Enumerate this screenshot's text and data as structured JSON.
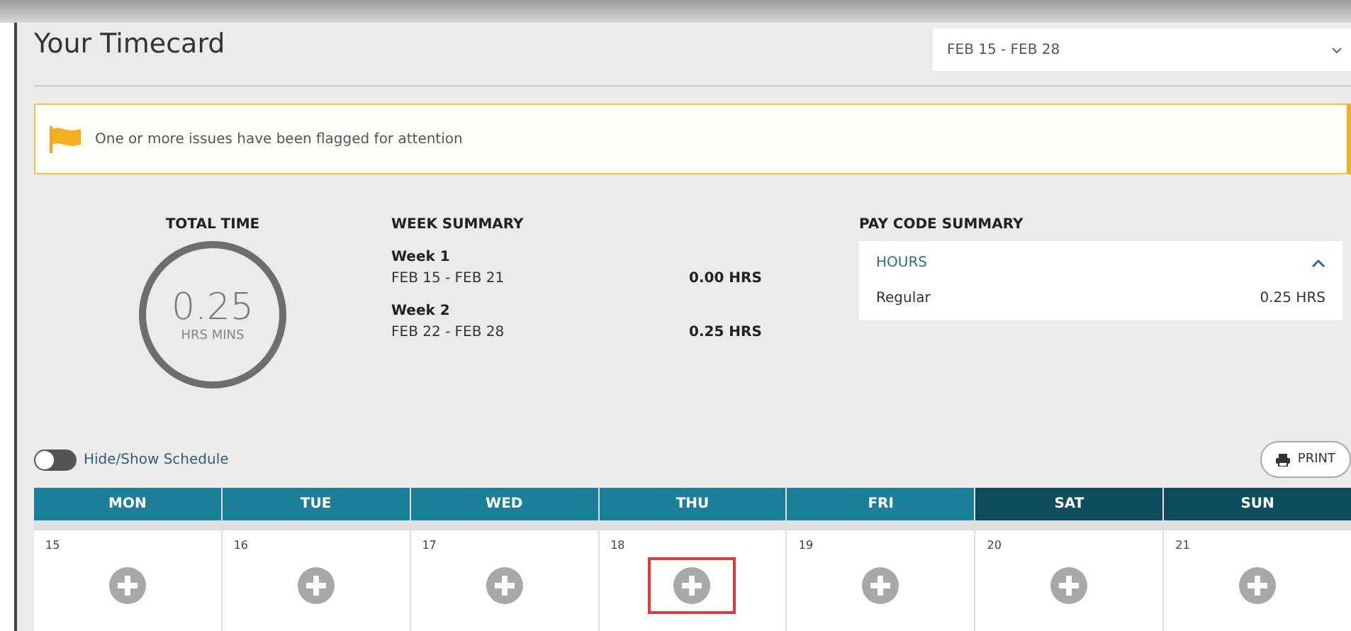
{
  "title": "Your Timecard",
  "period_select": {
    "value": "FEB 15 - FEB 28"
  },
  "alert": {
    "message": "One or more issues have been flagged for attention"
  },
  "total_time": {
    "heading": "TOTAL TIME",
    "value": "0.25",
    "unit": "HRS MINS"
  },
  "week_summary": {
    "heading": "WEEK SUMMARY",
    "weeks": [
      {
        "name": "Week 1",
        "range": "FEB 15 - FEB 21",
        "hours": "0.00 HRS"
      },
      {
        "name": "Week 2",
        "range": "FEB 22 - FEB 28",
        "hours": "0.25 HRS"
      }
    ]
  },
  "pay_code_summary": {
    "heading": "PAY CODE SUMMARY",
    "group": "HOURS",
    "expanded": true,
    "rows": [
      {
        "label": "Regular",
        "hours": "0.25 HRS"
      }
    ]
  },
  "schedule_toggle": {
    "label": "Hide/Show Schedule",
    "on": false
  },
  "print_button": {
    "label": "PRINT"
  },
  "days": [
    {
      "name": "MON",
      "date": "15",
      "kind": "weekday",
      "highlighted": false
    },
    {
      "name": "TUE",
      "date": "16",
      "kind": "weekday",
      "highlighted": false
    },
    {
      "name": "WED",
      "date": "17",
      "kind": "weekday",
      "highlighted": false
    },
    {
      "name": "THU",
      "date": "18",
      "kind": "weekday",
      "highlighted": true
    },
    {
      "name": "FRI",
      "date": "19",
      "kind": "weekday",
      "highlighted": false
    },
    {
      "name": "SAT",
      "date": "20",
      "kind": "weekend",
      "highlighted": false
    },
    {
      "name": "SUN",
      "date": "21",
      "kind": "weekend",
      "highlighted": false
    }
  ]
}
